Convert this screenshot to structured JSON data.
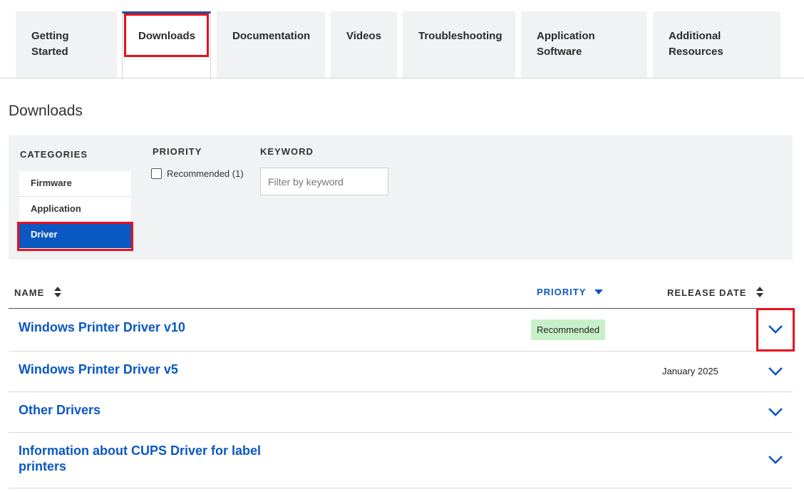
{
  "tabs": [
    {
      "label_line1": "Getting",
      "label_line2": "Started"
    },
    {
      "label_line1": "Downloads",
      "label_line2": ""
    },
    {
      "label_line1": "Documentation",
      "label_line2": ""
    },
    {
      "label_line1": "Videos",
      "label_line2": ""
    },
    {
      "label_line1": "Troubleshooting",
      "label_line2": ""
    },
    {
      "label_line1": "Application",
      "label_line2": "Software"
    },
    {
      "label_line1": "Additional",
      "label_line2": "Resources"
    }
  ],
  "page_title": "Downloads",
  "filters": {
    "categories_heading": "CATEGORIES",
    "categories": [
      "Firmware",
      "Application",
      "Driver"
    ],
    "selected_category": "Driver",
    "priority_heading": "PRIORITY",
    "priority_option": "Recommended (1)",
    "keyword_heading": "KEYWORD",
    "keyword_placeholder": "Filter by keyword"
  },
  "table": {
    "headers": {
      "name": "NAME",
      "priority": "PRIORITY",
      "release_date": "RELEASE DATE"
    },
    "rows": [
      {
        "name": "Windows Printer Driver v10",
        "priority": "Recommended",
        "date": ""
      },
      {
        "name": "Windows Printer Driver v5",
        "priority": "",
        "date": "January 2025"
      },
      {
        "name": "Other Drivers",
        "priority": "",
        "date": ""
      },
      {
        "name": "Information about CUPS Driver for label printers",
        "priority": "",
        "date": ""
      }
    ]
  },
  "colors": {
    "accent": "#0a58c2",
    "highlight": "#e8101e",
    "badge": "#c8f0c8",
    "panel": "#f1f2f4"
  },
  "icons": [
    "sort-icon",
    "sort-desc-icon",
    "chevron-down-icon"
  ]
}
